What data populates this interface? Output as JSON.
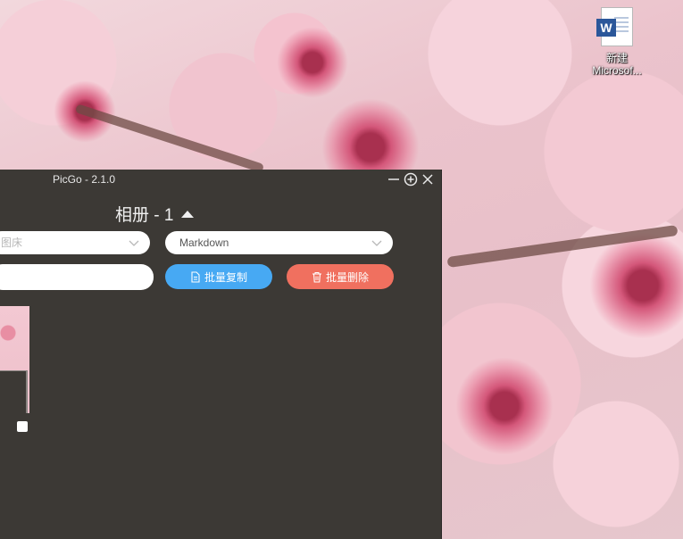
{
  "desktop": {
    "icon": {
      "name": "word-document-icon",
      "badge": "W",
      "label_line1": "新建",
      "label_line2": "Microsof..."
    }
  },
  "window": {
    "title": "PicGo - 2.1.0",
    "controls": [
      "minimize",
      "maximize",
      "close"
    ],
    "album_title": "相册 - 1",
    "picbed_select": {
      "value_visible": "图床"
    },
    "format_select": {
      "value": "Markdown"
    },
    "search": {
      "value": ""
    },
    "buttons": {
      "batch_copy": "批量复制",
      "batch_delete": "批量删除"
    },
    "colors": {
      "background": "#3c3935",
      "copy_button": "#47a9f3",
      "delete_button": "#f0705f"
    }
  }
}
